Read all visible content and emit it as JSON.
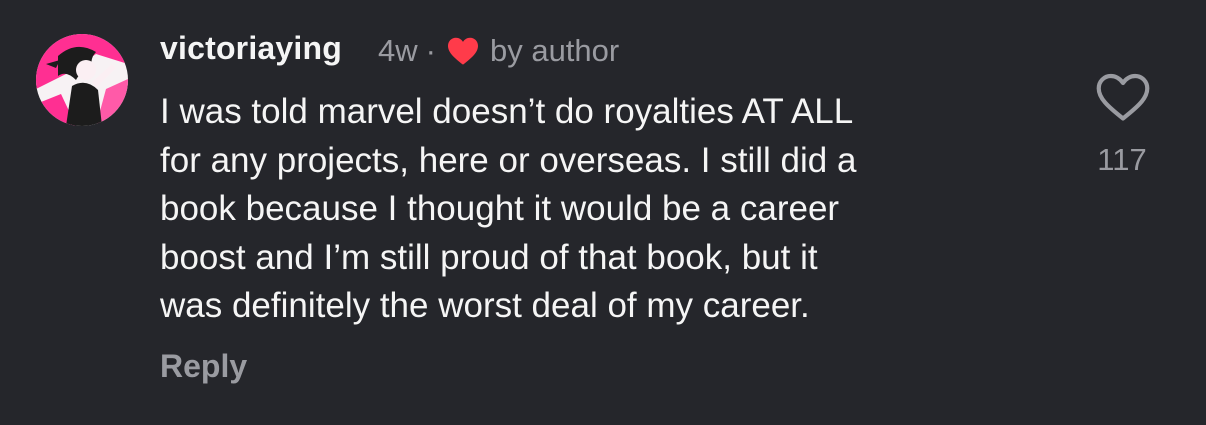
{
  "comment": {
    "username": "victoriaying",
    "timestamp": "4w",
    "separator": "·",
    "liked_by": "by author",
    "body_lines": [
      "I was told marvel doesn’t do royalties AT ALL",
      "for any projects, here or overseas. I still did a",
      "book because I thought it would be a career",
      "boost and I’m still proud of that book, but it",
      "was definitely the worst deal of my career."
    ],
    "reply_label": "Reply",
    "like_count": "117"
  },
  "icons": {
    "author_heart": "heart-filled-icon",
    "like": "heart-outline-icon"
  },
  "colors": {
    "background": "#25262b",
    "text_primary": "#f5f5f5",
    "text_secondary": "#9a9ba1",
    "heart_red": "#ff3b4a",
    "avatar_pink": "#ff2f92"
  }
}
